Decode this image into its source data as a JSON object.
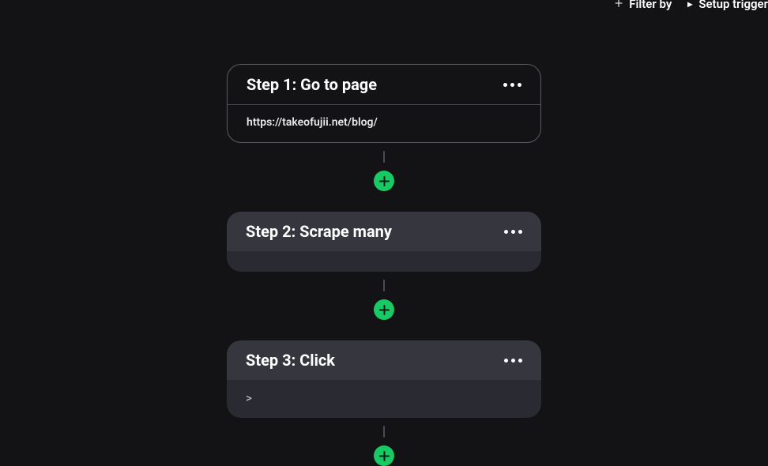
{
  "toolbar": {
    "filter_label": "Filter by",
    "trigger_label": "Setup trigger"
  },
  "steps": [
    {
      "title": "Step 1: Go to page",
      "body": "https://takeofujii.net/blog/",
      "style": "outlined",
      "bodyType": "text"
    },
    {
      "title": "Step 2: Scrape many",
      "body": "",
      "style": "filled",
      "bodyType": "empty"
    },
    {
      "title": "Step 3: Click",
      "body": ">",
      "style": "filled",
      "bodyType": "tall"
    }
  ]
}
